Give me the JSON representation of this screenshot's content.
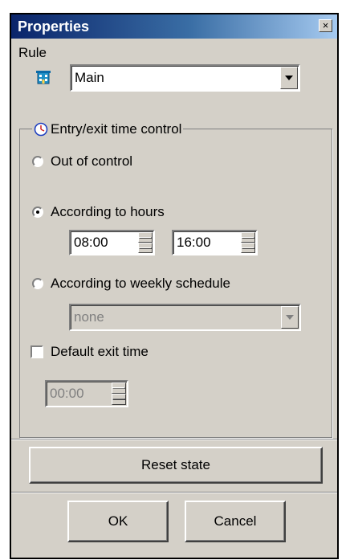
{
  "window": {
    "title": "Properties",
    "close_glyph": "×"
  },
  "rule": {
    "label": "Rule",
    "icon": "building-icon",
    "selected": "Main"
  },
  "group": {
    "icon": "clock-icon",
    "caption": "Entry/exit time control",
    "options": {
      "out_of_control": "Out of control",
      "according_to_hours": "According to hours",
      "weekly_schedule": "According to weekly schedule"
    },
    "selected_option": "according_to_hours",
    "hours_from": "08:00",
    "hours_to": "16:00",
    "schedule_selected": "none",
    "default_exit_label": "Default exit time",
    "default_exit_checked": false,
    "default_exit_value": "00:00"
  },
  "buttons": {
    "reset": "Reset state",
    "ok": "OK",
    "cancel": "Cancel"
  },
  "colors": {
    "face": "#d4d0c8",
    "title_start": "#0a246a",
    "title_end": "#a6caf0",
    "disabled_text": "#808080"
  }
}
